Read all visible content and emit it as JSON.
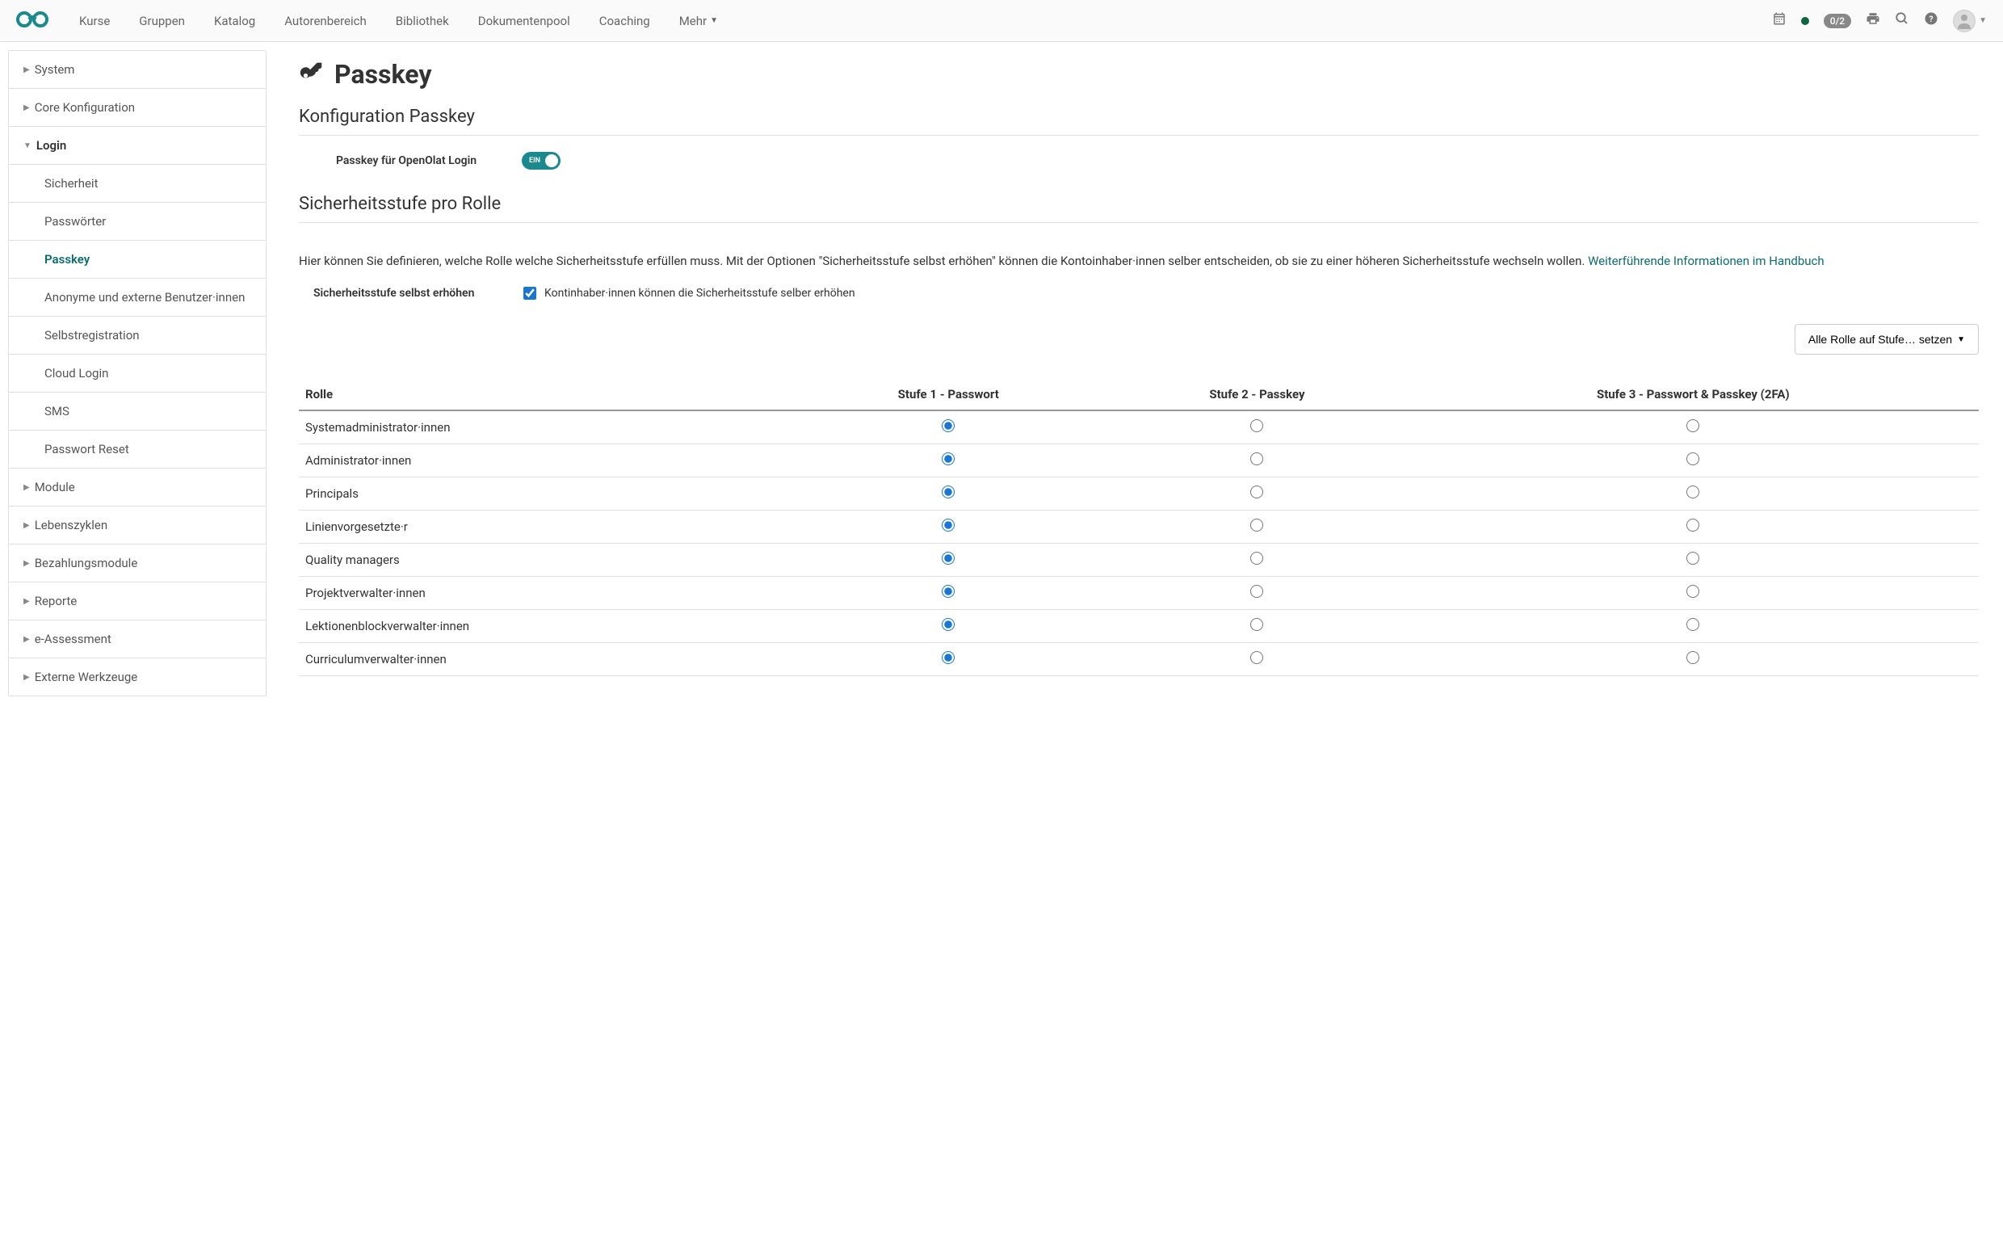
{
  "nav": {
    "items": [
      "Kurse",
      "Gruppen",
      "Katalog",
      "Autorenbereich",
      "Bibliothek",
      "Dokumentenpool",
      "Coaching"
    ],
    "more": "Mehr",
    "badge": "0/2"
  },
  "sidebar": {
    "top": [
      "System",
      "Core Konfiguration"
    ],
    "login": "Login",
    "login_items": [
      "Sicherheit",
      "Passwörter",
      "Passkey",
      "Anonyme und externe Benutzer·innen",
      "Selbstregistration",
      "Cloud Login",
      "SMS",
      "Passwort Reset"
    ],
    "bottom": [
      "Module",
      "Lebenszyklen",
      "Bezahlungsmodule",
      "Reporte",
      "e-Assessment",
      "Externe Werkzeuge"
    ]
  },
  "page": {
    "title": "Passkey",
    "section1": "Konfiguration Passkey",
    "toggle_label": "Passkey für OpenOlat Login",
    "toggle_state": "EIN",
    "section2": "Sicherheitsstufe pro Rolle",
    "description": "Hier können Sie definieren, welche Rolle welche Sicherheitsstufe erfüllen muss. Mit der Optionen \"Sicherheitsstufe selbst erhöhen\" können die Kontoinhaber·innen selber entscheiden, ob sie zu einer höheren Sicherheitsstufe wechseln wollen. ",
    "link": "Weiterführende Informationen im Handbuch",
    "self_raise_label": "Sicherheitsstufe selbst erhöhen",
    "self_raise_checkbox": "Kontinhaber·innen können die Sicherheitsstufe selber erhöhen",
    "dropdown": "Alle Rolle auf Stufe… setzen",
    "table": {
      "headers": [
        "Rolle",
        "Stufe 1 - Passwort",
        "Stufe 2 - Passkey",
        "Stufe 3 - Passwort & Passkey (2FA)"
      ],
      "rows": [
        {
          "role": "Systemadministrator·innen",
          "level": 1
        },
        {
          "role": "Administrator·innen",
          "level": 1
        },
        {
          "role": "Principals",
          "level": 1
        },
        {
          "role": "Linienvorgesetzte·r",
          "level": 1
        },
        {
          "role": "Quality managers",
          "level": 1
        },
        {
          "role": "Projektverwalter·innen",
          "level": 1
        },
        {
          "role": "Lektionenblockverwalter·innen",
          "level": 1
        },
        {
          "role": "Curriculumverwalter·innen",
          "level": 1
        }
      ]
    }
  }
}
